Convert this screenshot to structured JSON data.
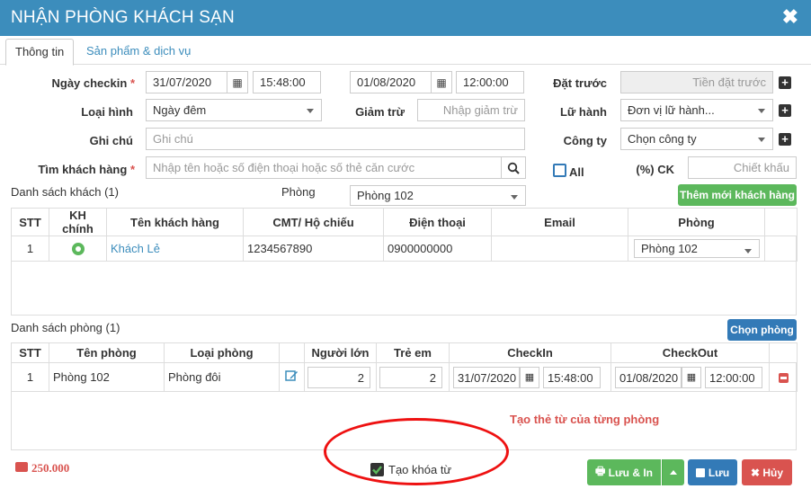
{
  "window": {
    "title": "NHẬN PHÒNG KHÁCH SẠN",
    "close": "✖"
  },
  "tabs": [
    {
      "label": "Thông tin"
    },
    {
      "label": "Sản phẩm & dịch vụ"
    }
  ],
  "form": {
    "checkin_label": "Ngày checkin",
    "required_mark": "*",
    "checkin_date": "31/07/2020",
    "checkin_time": "15:48:00",
    "checkout_date": "01/08/2020",
    "checkout_time": "12:00:00",
    "deposit_label": "Đặt trước",
    "deposit_placeholder": "Tiền đặt trước",
    "type_label": "Loại hình",
    "type_value": "Ngày đêm",
    "discount_label": "Giảm trừ",
    "discount_placeholder": "Nhập giảm trừ",
    "travel_label": "Lữ hành",
    "travel_value": "Đơn vị lữ hành...",
    "note_label": "Ghi chú",
    "note_placeholder": "Ghi chú",
    "company_label": "Công ty",
    "company_value": "Chọn công ty",
    "search_label": "Tìm khách hàng",
    "search_placeholder": "Nhập tên hoặc số điện thoại hoặc số thẻ căn cước",
    "all_label": "All",
    "ck_label": "(%) CK",
    "ck_placeholder": "Chiết khấu"
  },
  "guests": {
    "title": "Danh sách khách (1)",
    "room_filter_label": "Phòng",
    "room_filter_value": "Phòng 102",
    "add_button": "Thêm mới khách hàng",
    "columns": [
      "STT",
      "KH chính",
      "Tên khách hàng",
      "CMT/ Hộ chiếu",
      "Điện thoại",
      "Email",
      "Phòng"
    ],
    "rows": [
      {
        "stt": "1",
        "name": "Khách Lẻ",
        "id": "1234567890",
        "phone": "0900000000",
        "email": "",
        "room": "Phòng 102"
      }
    ]
  },
  "rooms": {
    "title": "Danh sách phòng (1)",
    "choose_button": "Chọn phòng",
    "columns": [
      "STT",
      "Tên phòng",
      "Loại phòng",
      "Người lớn",
      "Trẻ em",
      "CheckIn",
      "CheckOut"
    ],
    "rows": [
      {
        "stt": "1",
        "name": "Phòng 102",
        "type": "Phòng đôi",
        "adults": "2",
        "children": "2",
        "in_date": "31/07/2020",
        "in_time": "15:48:00",
        "out_date": "01/08/2020",
        "out_time": "12:00:00"
      }
    ]
  },
  "annotation": "Tạo thẻ từ của từng phòng",
  "footer": {
    "total": "250.000",
    "keycard_label": "Tạo khóa từ",
    "save_print": "Lưu & In",
    "save": "Lưu",
    "cancel": "Hủy"
  },
  "colors": {
    "header": "#3c8dbc",
    "green": "#5cb85c",
    "blue": "#337ab7",
    "red": "#d9534f"
  }
}
